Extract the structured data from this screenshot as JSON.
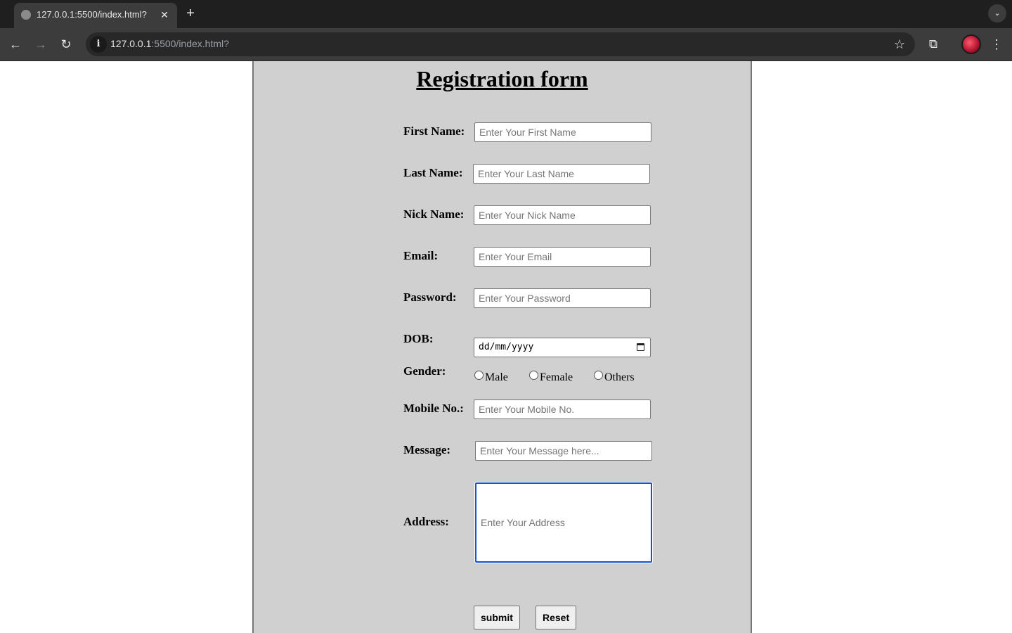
{
  "browser": {
    "tab_title": "127.0.0.1:5500/index.html?",
    "url_host": "127.0.0.1",
    "url_path": ":5500/index.html?"
  },
  "form": {
    "title": "Registration form",
    "first_name": {
      "label": "First Name:",
      "placeholder": "Enter Your First Name"
    },
    "last_name": {
      "label": "Last Name:",
      "placeholder": "Enter Your Last Name"
    },
    "nick_name": {
      "label": "Nick Name:",
      "placeholder": "Enter Your Nick Name"
    },
    "email": {
      "label": "Email:",
      "placeholder": "Enter Your Email"
    },
    "password": {
      "label": "Password:",
      "placeholder": "Enter Your Password"
    },
    "dob": {
      "label": "DOB:",
      "placeholder": "dd/mm/yyyy"
    },
    "gender": {
      "label": "Gender:",
      "options": [
        "Male",
        "Female",
        "Others"
      ]
    },
    "mobile": {
      "label": "Mobile No.:",
      "placeholder": "Enter Your Mobile No."
    },
    "message": {
      "label": "Message:",
      "placeholder": "Enter Your Message here..."
    },
    "address": {
      "label": "Address:",
      "placeholder": "Enter Your Address"
    },
    "submit_label": "submit",
    "reset_label": "Reset"
  }
}
